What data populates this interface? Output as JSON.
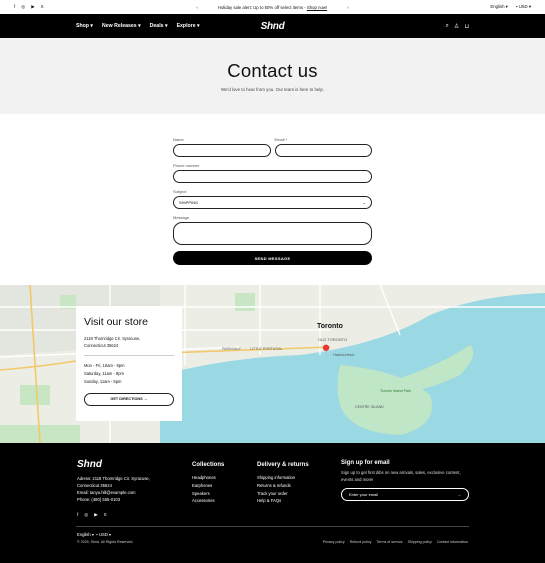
{
  "topbar": {
    "socials": [
      "f",
      "◎",
      "▶",
      "X"
    ],
    "promo_prefix": "Holiday sale alert: Up to 50% off select items - ",
    "promo_link": "Shop now!",
    "language": "English",
    "currency": "USD"
  },
  "nav": {
    "menu": [
      "Shop",
      "New Releases",
      "Deals",
      "Explore"
    ],
    "logo": "Shnd"
  },
  "hero": {
    "title": "Contact us",
    "subtitle": "We'd love to hear from you. Our team is here to help."
  },
  "form": {
    "name_label": "Name",
    "email_label": "Email *",
    "phone_label": "Phone number",
    "subject_label": "Subject",
    "subject_value": "SHIPPING",
    "message_label": "Message",
    "send_label": "SEND MESSAGE"
  },
  "map": {
    "labels": [
      "Toronto",
      "OLD TORONTO",
      "Harbourfront",
      "LITTLE PORTUGAL",
      "PARKDALE",
      "CENTRE ISLAND",
      "Toronto Island Park"
    ]
  },
  "store": {
    "title": "Visit our store",
    "address_line1": "2118 Thornridge Cir. Syracuse,",
    "address_line2": "Connecticut 35624",
    "hours_1": "Mon - Fri, 10am - 9pm",
    "hours_2": "Saturday, 11am - 9pm",
    "hours_3": "Sunday, 11am - 5pm",
    "directions": "GET DIRECTIONS →"
  },
  "footer": {
    "logo": "Shnd",
    "address_line1": "Adress: 2118 Thornridge Cir. Syracuse,",
    "address_line2": "Connecticut 35624",
    "email": "Email: tanya.hill@example.com",
    "phone": "Phone: (480) 555-0103",
    "socials": [
      "f",
      "◎",
      "▶",
      "X"
    ],
    "collections_title": "Collections",
    "collections": [
      "Headphones",
      "Earphones",
      "Speakers",
      "Accessories"
    ],
    "delivery_title": "Delivery & returns",
    "delivery": [
      "Shipping information",
      "Returns & refunds",
      "Track your order",
      "Help & FAQs"
    ],
    "signup_title": "Sign up for email",
    "signup_text": "Sign up to get first dibs on new arrivals, sales, exclusive content, events and more!",
    "email_placeholder": "Enter your email",
    "language": "English",
    "currency": "USD",
    "copyright": "© 2025, Shnd. All Rights Reserved.",
    "links": [
      "Privacy policy",
      "Refund policy",
      "Terms of service",
      "Shipping policy",
      "Contact information"
    ]
  }
}
